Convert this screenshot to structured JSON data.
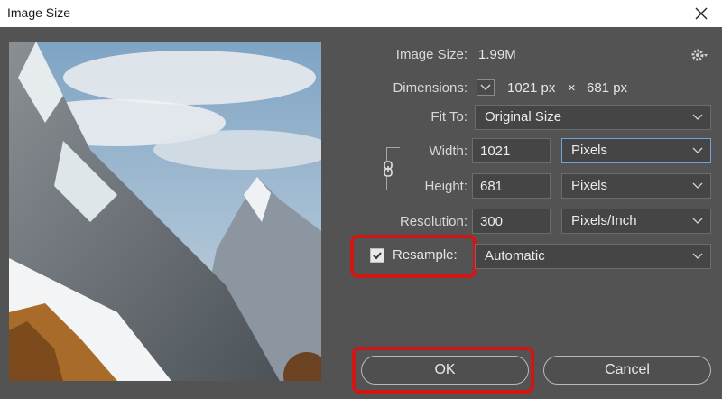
{
  "window": {
    "title": "Image Size"
  },
  "info": {
    "image_size_label": "Image Size:",
    "image_size_value": "1.99M",
    "dimensions_label": "Dimensions:",
    "dim_width": "1021 px",
    "dim_x": "×",
    "dim_height": "681 px"
  },
  "fit_to": {
    "label": "Fit To:",
    "value": "Original Size"
  },
  "width": {
    "label": "Width:",
    "value": "1021",
    "unit": "Pixels"
  },
  "height": {
    "label": "Height:",
    "value": "681",
    "unit": "Pixels"
  },
  "resolution": {
    "label": "Resolution:",
    "value": "300",
    "unit": "Pixels/Inch"
  },
  "resample": {
    "label": "Resample:",
    "checked": true,
    "value": "Automatic"
  },
  "buttons": {
    "ok": "OK",
    "cancel": "Cancel"
  },
  "colors": {
    "dialog_bg": "#535353",
    "highlight": "#d11616",
    "focus": "#6fa3d8"
  },
  "icons": [
    "close-icon",
    "gear-icon",
    "chevron-down-icon",
    "link-icon",
    "checkmark-icon"
  ]
}
